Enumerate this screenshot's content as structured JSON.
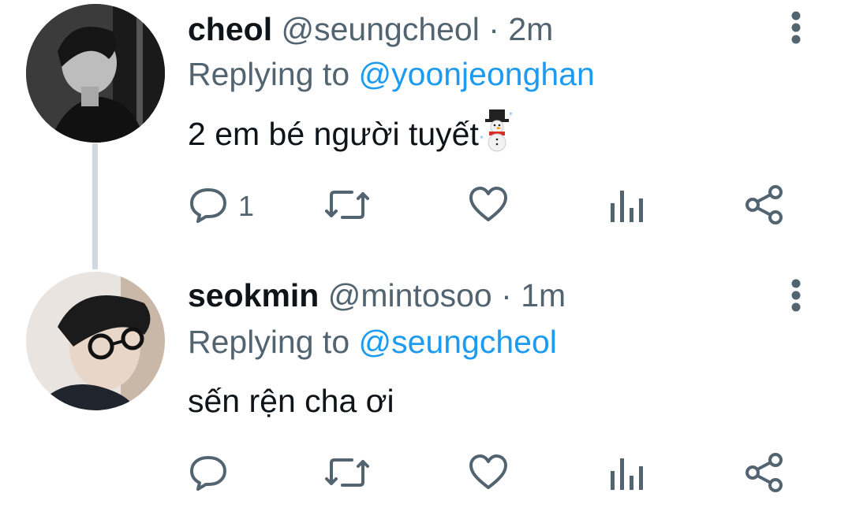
{
  "colors": {
    "text": "#0f1419",
    "secondary": "#536471",
    "accent": "#1d9bf0",
    "thread_line": "#cfd9de"
  },
  "tweets": [
    {
      "name": "cheol",
      "handle": "@seungcheol",
      "separator": "·",
      "time": "2m",
      "replying_prefix": "Replying to",
      "replying_to": "@yoonjeonghan",
      "text": "2 em bé người tuyết",
      "emoji_icon": "snowman-icon",
      "reply_count": "1",
      "actions": [
        "reply-icon",
        "retweet-icon",
        "like-icon",
        "analytics-icon",
        "share-icon"
      ]
    },
    {
      "name": "seokmin",
      "handle": "@mintosoo",
      "separator": "·",
      "time": "1m",
      "replying_prefix": "Replying to",
      "replying_to": "@seungcheol",
      "text": "sến rện cha ơi",
      "reply_count": "",
      "actions": [
        "reply-icon",
        "retweet-icon",
        "like-icon",
        "analytics-icon",
        "share-icon"
      ]
    }
  ]
}
